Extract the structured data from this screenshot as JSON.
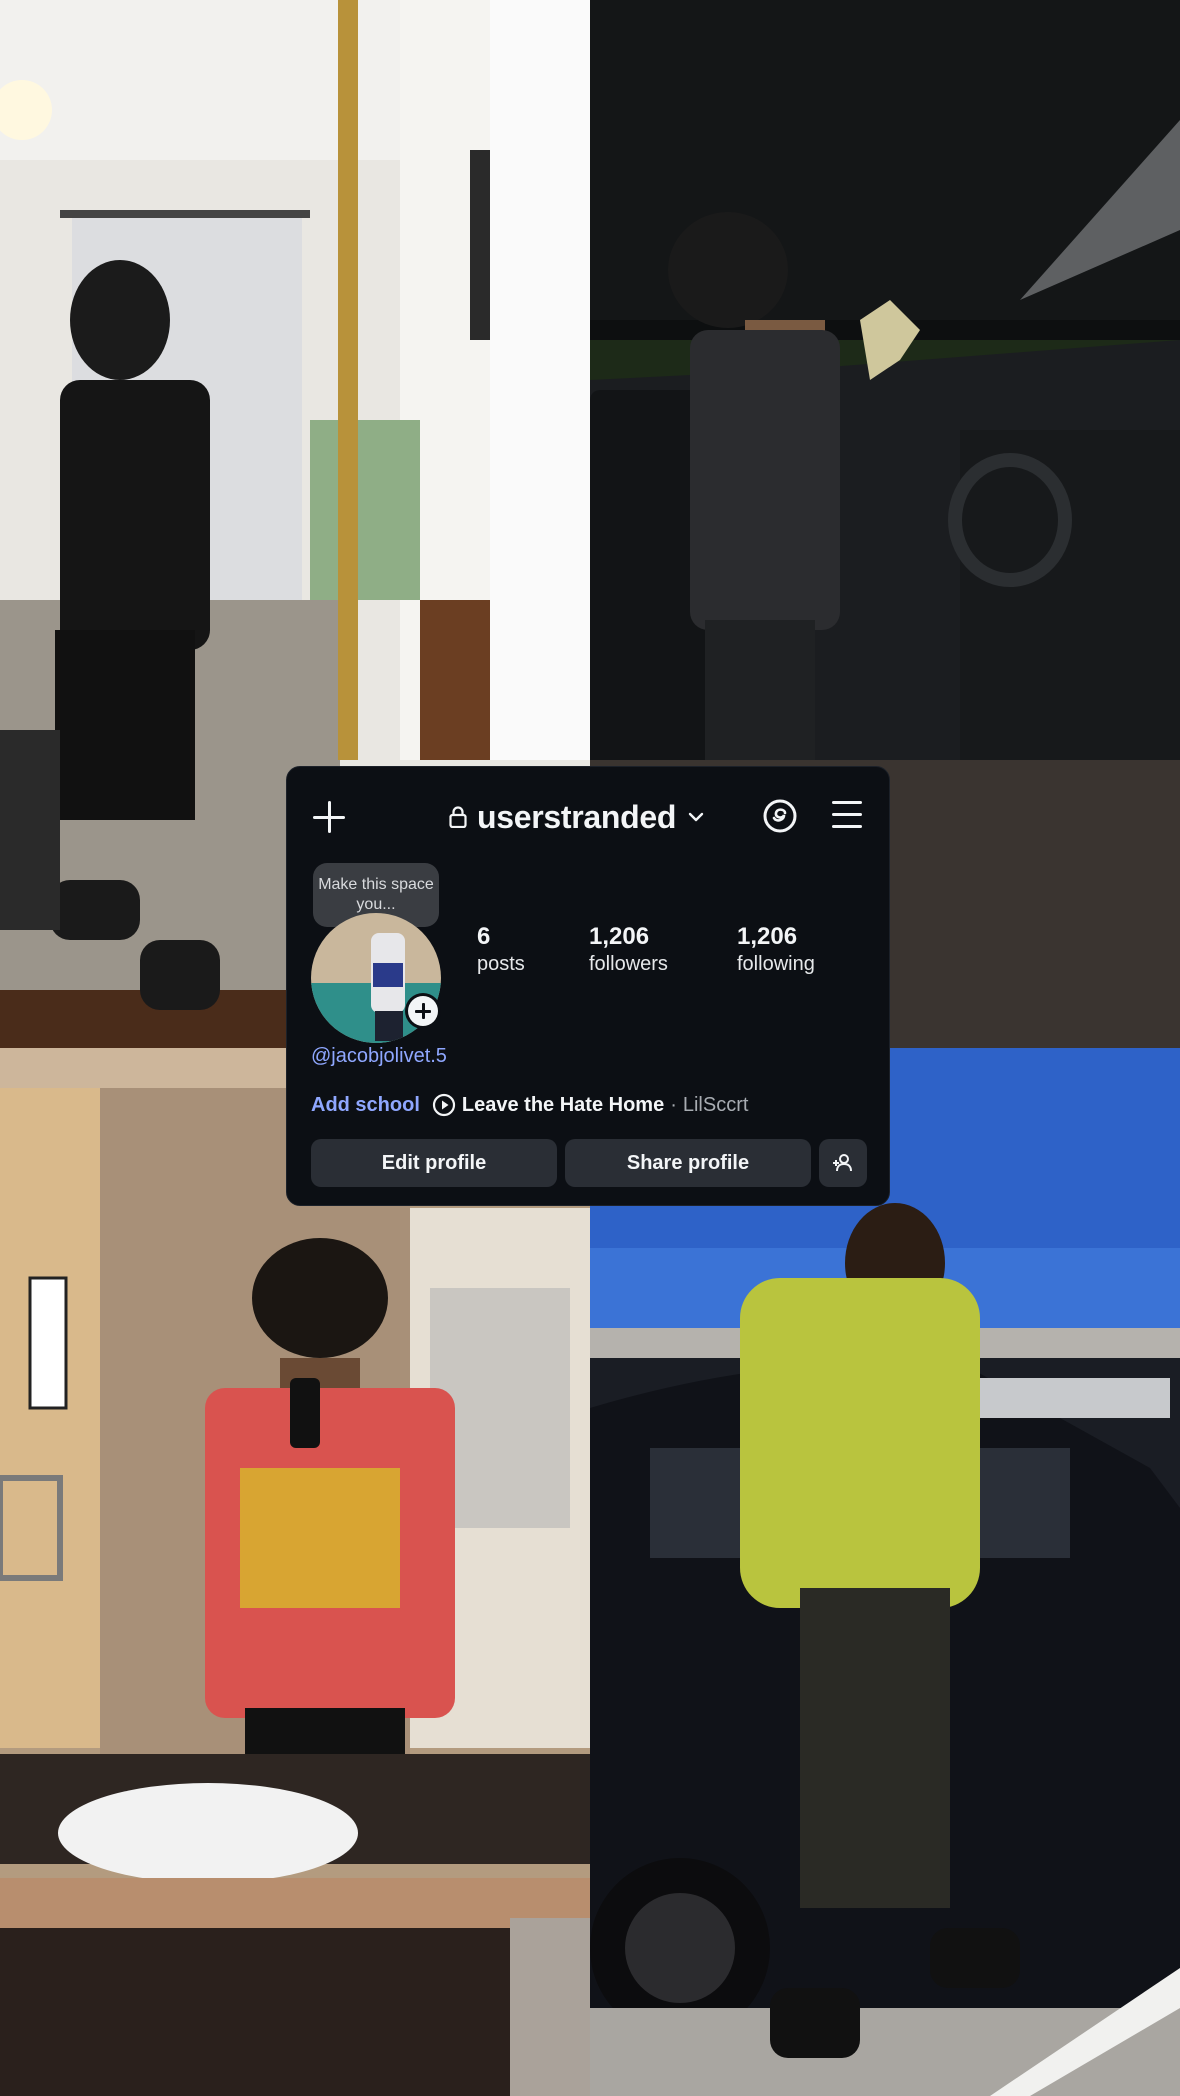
{
  "profile": {
    "username": "userstranded",
    "note": "Make this space you...",
    "handle": "@jacobjolivet.5",
    "stats": [
      {
        "value": "6",
        "label": "posts"
      },
      {
        "value": "1,206",
        "label": "followers"
      },
      {
        "value": "1,206",
        "label": "following"
      }
    ],
    "add_school": "Add school",
    "music": {
      "song": "Leave the Hate Home",
      "separator": "·",
      "artist": "LilSccrt"
    },
    "buttons": {
      "edit": "Edit profile",
      "share": "Share profile"
    },
    "icons": [
      "plus-icon",
      "lock-icon",
      "chevron-down-icon",
      "threads-icon",
      "menu-icon",
      "play-icon",
      "add-person-icon"
    ]
  },
  "colors": {
    "card_bg": "#0c0f14",
    "link": "#8fa7ff",
    "button_bg": "#2a2e35"
  }
}
